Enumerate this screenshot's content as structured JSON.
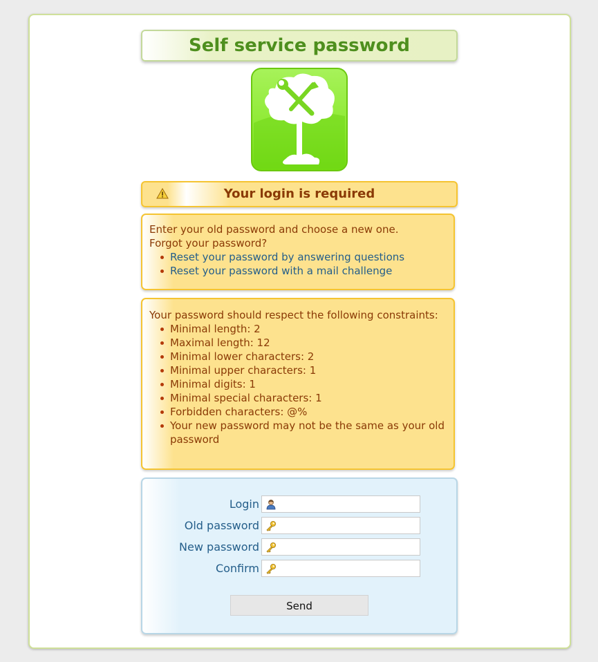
{
  "title": "Self service password",
  "logo": {
    "icon": "tree-wrench-logo",
    "color": "#7ee11d"
  },
  "banner": {
    "icon": "warning-icon",
    "text": "Your login is required"
  },
  "intro": {
    "line1": "Enter your old password and choose a new one.",
    "line2": "Forgot your password?",
    "links": [
      "Reset your password by answering questions",
      "Reset your password with a mail challenge"
    ]
  },
  "policy": {
    "heading": "Your password should respect the following constraints:",
    "items": [
      "Minimal length: 2",
      "Maximal length: 12",
      "Minimal lower characters: 2",
      "Minimal upper characters: 1",
      "Minimal digits: 1",
      "Minimal special characters: 1",
      "Forbidden characters: @%",
      "Your new password may not be the same as your old password"
    ]
  },
  "form": {
    "login_label": "Login",
    "login_value": "",
    "old_password_label": "Old password",
    "new_password_label": "New password",
    "confirm_label": "Confirm",
    "send_label": "Send"
  },
  "colors": {
    "accent_green": "#4e8f1e",
    "warning_text": "#8a3a06",
    "link_blue": "#245e8a",
    "warning_bg": "#fde28e",
    "form_bg": "#e2f2fb"
  }
}
